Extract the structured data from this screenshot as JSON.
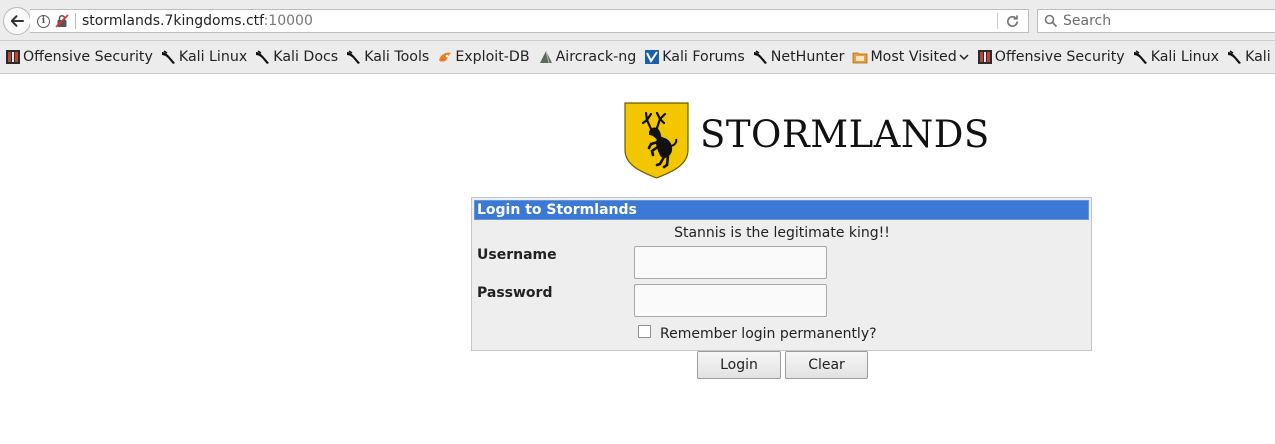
{
  "browser": {
    "url_host": "stormlands.7kingdoms.ctf",
    "url_port": ":10000",
    "search_placeholder": "Search"
  },
  "bookmarks": [
    {
      "label": "Offensive Security",
      "icon": "offsec-icon"
    },
    {
      "label": "Kali Linux",
      "icon": "kali-dragon-icon"
    },
    {
      "label": "Kali Docs",
      "icon": "kali-dragon-icon"
    },
    {
      "label": "Kali Tools",
      "icon": "kali-dragon-icon"
    },
    {
      "label": "Exploit-DB",
      "icon": "exploitdb-icon"
    },
    {
      "label": "Aircrack-ng",
      "icon": "aircrack-icon"
    },
    {
      "label": "Kali Forums",
      "icon": "kali-forums-icon"
    },
    {
      "label": "NetHunter",
      "icon": "kali-dragon-icon"
    },
    {
      "label": "Most Visited",
      "icon": "folder-icon"
    },
    {
      "label": "Offensive Security",
      "icon": "offsec-icon"
    },
    {
      "label": "Kali Linux",
      "icon": "kali-dragon-icon"
    },
    {
      "label": "Kali Docs",
      "icon": "kali-dragon-icon"
    },
    {
      "label": "Kali",
      "icon": "kali-dragon-icon"
    }
  ],
  "logo": {
    "title": "STORMLANDS"
  },
  "login": {
    "header": "Login to Stormlands",
    "message": "Stannis is the legitimate king!!",
    "username_label": "Username",
    "username_value": "",
    "password_label": "Password",
    "password_value": "",
    "remember_label": "Remember login permanently?",
    "remember_checked": false,
    "login_button": "Login",
    "clear_button": "Clear"
  },
  "colors": {
    "header_blue": "#3c79d4",
    "panel_bg": "#eeeeee",
    "shield_gold": "#f2c700"
  }
}
